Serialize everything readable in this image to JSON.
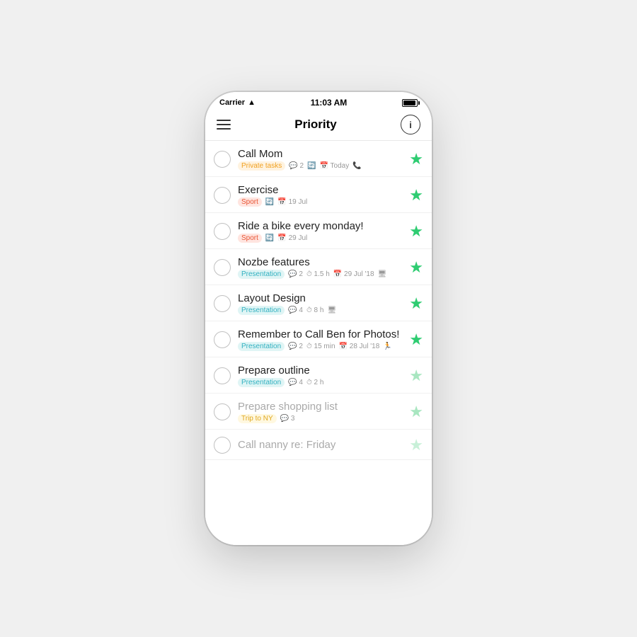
{
  "statusBar": {
    "carrier": "Carrier",
    "wifi": "WiFi",
    "time": "11:03 AM",
    "battery": "full"
  },
  "navBar": {
    "title": "Priority",
    "infoLabel": "i"
  },
  "tasks": [
    {
      "id": 1,
      "title": "Call Mom",
      "tag": "Private tasks",
      "tagClass": "tag-private",
      "meta": [
        "💬 2",
        "🔄",
        "📅 Today",
        "📞"
      ],
      "metaItems": [
        {
          "icon": "💬",
          "text": "2"
        },
        {
          "icon": "🔄",
          "text": ""
        },
        {
          "icon": "📅",
          "text": "Today"
        },
        {
          "icon": "📞",
          "text": ""
        }
      ],
      "starClass": "star-green",
      "faded": false
    },
    {
      "id": 2,
      "title": "Exercise",
      "tag": "Sport",
      "tagClass": "tag-sport",
      "metaItems": [
        {
          "icon": "🔄",
          "text": ""
        },
        {
          "icon": "📅",
          "text": "19 Jul"
        }
      ],
      "starClass": "star-green",
      "faded": false
    },
    {
      "id": 3,
      "title": "Ride a bike every monday!",
      "tag": "Sport",
      "tagClass": "tag-sport",
      "metaItems": [
        {
          "icon": "🔄",
          "text": ""
        },
        {
          "icon": "📅",
          "text": "29 Jul"
        }
      ],
      "starClass": "star-green",
      "faded": false
    },
    {
      "id": 4,
      "title": "Nozbe features",
      "tag": "Presentation",
      "tagClass": "tag-presentation",
      "metaItems": [
        {
          "icon": "💬",
          "text": "2"
        },
        {
          "icon": "⏱",
          "text": "1.5 h"
        },
        {
          "icon": "📅",
          "text": "29 Jul '18"
        },
        {
          "icon": "🖥",
          "text": ""
        }
      ],
      "starClass": "star-green",
      "faded": false
    },
    {
      "id": 5,
      "title": "Layout Design",
      "tag": "Presentation",
      "tagClass": "tag-presentation",
      "metaItems": [
        {
          "icon": "💬",
          "text": "4"
        },
        {
          "icon": "⏱",
          "text": "8 h"
        },
        {
          "icon": "🖥",
          "text": ""
        }
      ],
      "starClass": "star-green",
      "faded": false
    },
    {
      "id": 6,
      "title": "Remember to Call Ben for Photos!",
      "tag": "Presentation",
      "tagClass": "tag-presentation",
      "metaItems": [
        {
          "icon": "💬",
          "text": "2"
        },
        {
          "icon": "⏱",
          "text": "15 min"
        },
        {
          "icon": "📅",
          "text": "28 Jul '18"
        },
        {
          "icon": "🏃",
          "text": ""
        }
      ],
      "starClass": "star-green",
      "faded": false
    },
    {
      "id": 7,
      "title": "Prepare outline",
      "tag": "Presentation",
      "tagClass": "tag-presentation",
      "metaItems": [
        {
          "icon": "💬",
          "text": "4"
        },
        {
          "icon": "⏱",
          "text": "2 h"
        }
      ],
      "starClass": "star-light",
      "faded": false
    },
    {
      "id": 8,
      "title": "Prepare shopping list",
      "tag": "Trip to NY",
      "tagClass": "tag-trip",
      "metaItems": [
        {
          "icon": "💬",
          "text": "3"
        }
      ],
      "starClass": "star-light",
      "faded": true
    },
    {
      "id": 9,
      "title": "Call nanny re: Friday",
      "tag": "",
      "tagClass": "",
      "metaItems": [],
      "starClass": "star-faded",
      "faded": true
    }
  ]
}
